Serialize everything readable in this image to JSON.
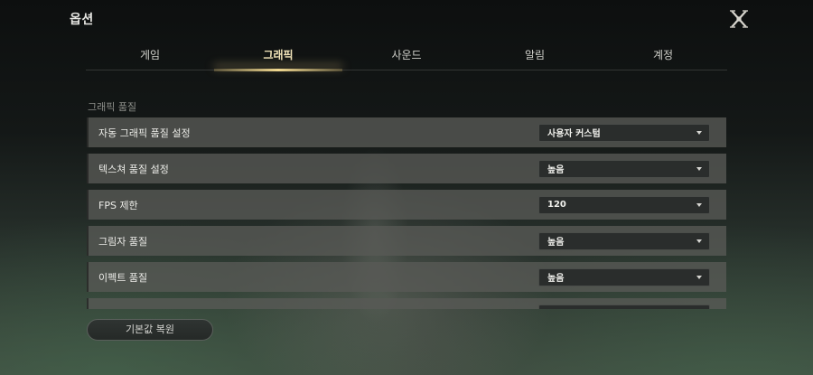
{
  "window": {
    "title": "옵션"
  },
  "tabs": [
    {
      "label": "게임",
      "active": false
    },
    {
      "label": "그래픽",
      "active": true
    },
    {
      "label": "사운드",
      "active": false
    },
    {
      "label": "알림",
      "active": false
    },
    {
      "label": "계정",
      "active": false
    }
  ],
  "section": {
    "label": "그래픽 품질"
  },
  "settings": [
    {
      "label": "자동 그래픽 품질 설정",
      "value": "사용자 커스텀"
    },
    {
      "label": "텍스쳐 품질 설정",
      "value": "높음"
    },
    {
      "label": "FPS 제한",
      "value": "120"
    },
    {
      "label": "그림자 품질",
      "value": "높음"
    },
    {
      "label": "이펙트 품질",
      "value": "높음"
    },
    {
      "label": "",
      "value": ""
    }
  ],
  "footer": {
    "reset_label": "기본값 복원"
  },
  "icons": {
    "close": "close-x-icon",
    "dropdown": "caret-down-icon"
  },
  "colors": {
    "accent": "#f0d890",
    "row_bg": "#585a56",
    "select_bg": "#2a2d2c"
  }
}
